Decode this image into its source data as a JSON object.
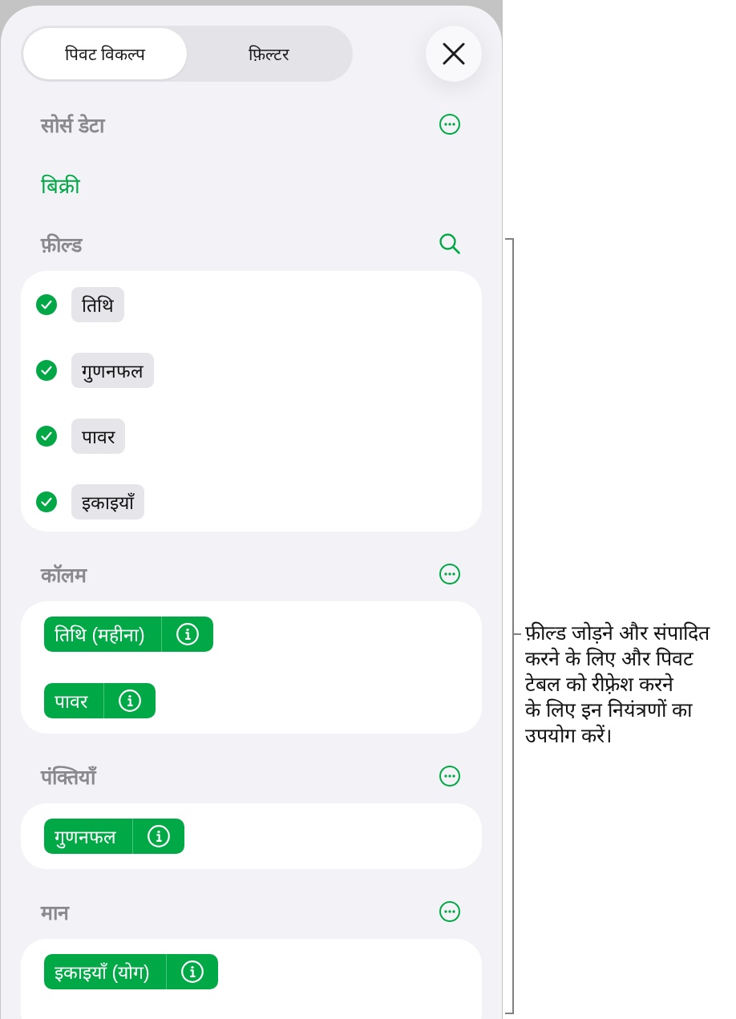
{
  "tabs": [
    {
      "label": "पिवट विकल्प",
      "selected": true
    },
    {
      "label": "फ़िल्टर",
      "selected": false
    }
  ],
  "sections": [
    {
      "title": "सोर्स डेटा",
      "action": {
        "kind": "more"
      },
      "kind": "source",
      "source": "बिक्री"
    },
    {
      "title": "फ़ील्ड",
      "action": {
        "kind": "search"
      },
      "kind": "fields",
      "fields": [
        {
          "label": "तिथि",
          "checked": true
        },
        {
          "label": "गुणनफल",
          "checked": true
        },
        {
          "label": "पावर",
          "checked": true
        },
        {
          "label": "इकाइयाँ",
          "checked": true
        }
      ]
    },
    {
      "title": "कॉलम",
      "action": {
        "kind": "more"
      },
      "kind": "chips",
      "chips": [
        "तिथि (महीना)",
        "पावर"
      ]
    },
    {
      "title": "पंक्तियाँ",
      "action": {
        "kind": "more"
      },
      "kind": "chips",
      "chips": [
        "गुणनफल"
      ]
    },
    {
      "title": "मान",
      "action": {
        "kind": "more"
      },
      "kind": "chips",
      "chips": [
        "इकाइयाँ (योग)"
      ]
    }
  ],
  "callout": "फ़ील्ड जोड़ने और संपादित\nकरने के लिए और पिवट\nटेबल को रीफ़्रेश करने\nके लिए इन नियंत्रणों का\nउपयोग करें।"
}
